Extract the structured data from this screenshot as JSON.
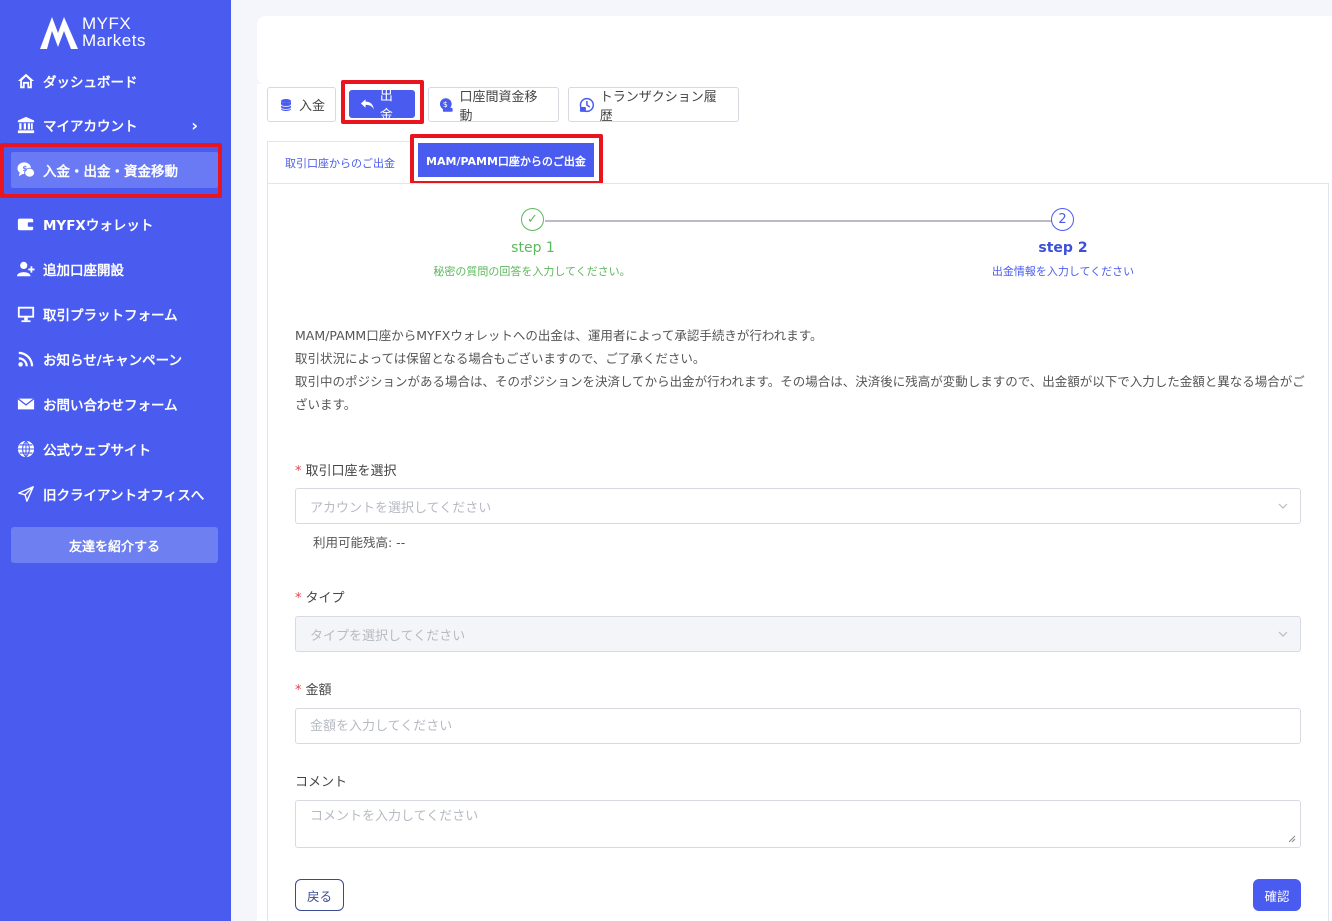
{
  "brand": {
    "line1": "MYFX",
    "line2": "Markets"
  },
  "sidebar": {
    "items": [
      {
        "label": "ダッシュボード",
        "icon": "home-icon"
      },
      {
        "label": "マイアカウント",
        "icon": "bank-icon",
        "chevron": "›"
      },
      {
        "label": "入金・出金・資金移動",
        "icon": "money-chat-icon"
      },
      {
        "label": "MYFXウォレット",
        "icon": "wallet-icon"
      },
      {
        "label": "追加口座開設",
        "icon": "add-user-icon"
      },
      {
        "label": "取引プラットフォーム",
        "icon": "monitor-icon"
      },
      {
        "label": "お知らせ/キャンペーン",
        "icon": "rss-icon"
      },
      {
        "label": "お問い合わせフォーム",
        "icon": "mail-icon"
      },
      {
        "label": "公式ウェブサイト",
        "icon": "globe-icon"
      },
      {
        "label": "旧クライアントオフィスへ",
        "icon": "send-icon"
      }
    ],
    "refer_button": "友達を紹介する"
  },
  "tabs": [
    {
      "label": "入金",
      "icon": "coins-icon"
    },
    {
      "label": "出金",
      "icon": "return-arrow-icon"
    },
    {
      "label": "口座間資金移動",
      "icon": "transfer-icon"
    },
    {
      "label": "トランザクション履歴",
      "icon": "history-icon"
    }
  ],
  "subtabs": [
    {
      "label": "取引口座からのご出金"
    },
    {
      "label": "MAM/PAMM口座からのご出金"
    }
  ],
  "steps": [
    {
      "number": "✓",
      "title": "step 1",
      "desc": "秘密の質問の回答を入力してください。"
    },
    {
      "number": "2",
      "title": "step 2",
      "desc": "出金情報を入力してください"
    }
  ],
  "notice": [
    "MAM/PAMM口座からMYFXウォレットへの出金は、運用者によって承認手続きが行われます。",
    "取引状況によっては保留となる場合もございますので、ご了承ください。",
    "取引中のポジションがある場合は、そのポジションを決済してから出金が行われます。その場合は、決済後に残高が変動しますので、出金額が以下で入力した金額と異なる場合がございます。"
  ],
  "form": {
    "required_mark": "*",
    "account": {
      "label": "取引口座を選択",
      "placeholder": "アカウントを選択してください"
    },
    "balance": "利用可能残高: --",
    "type": {
      "label": "タイプ",
      "placeholder": "タイプを選択してください"
    },
    "amount": {
      "label": "金額",
      "placeholder": "金額を入力してください"
    },
    "comment": {
      "label": "コメント",
      "placeholder": "コメントを入力してください"
    },
    "back_button": "戻る",
    "confirm_button": "確認"
  },
  "colors": {
    "sidebar": "#4a5cf0",
    "accent": "#4a5cf0",
    "success": "#5cb85c",
    "highlight": "#e8141e",
    "required": "#e8414b"
  }
}
